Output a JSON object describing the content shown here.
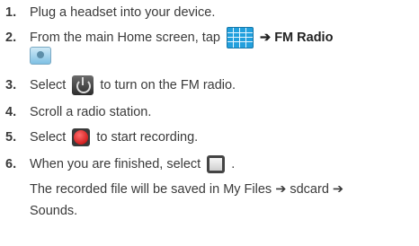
{
  "steps": [
    {
      "num": "1.",
      "text": "Plug a headset into your device."
    },
    {
      "num": "2.",
      "before": "From the main Home screen, tap",
      "arrow": "➔",
      "app": "FM Radio",
      "icons": [
        "apps-grid-icon",
        "fm-radio-icon"
      ]
    },
    {
      "num": "3.",
      "before": "Select",
      "after": "to turn on the FM radio.",
      "icon": "power-icon"
    },
    {
      "num": "4.",
      "text": "Scroll a radio station."
    },
    {
      "num": "5.",
      "before": "Select",
      "after": "to start recording.",
      "icon": "record-icon"
    },
    {
      "num": "6.",
      "before": "When you are finished, select",
      "after": ".",
      "icon": "stop-icon"
    }
  ],
  "note": {
    "line1": "The recorded file will be saved in My Files ➔ sdcard ➔",
    "line2": "Sounds."
  }
}
